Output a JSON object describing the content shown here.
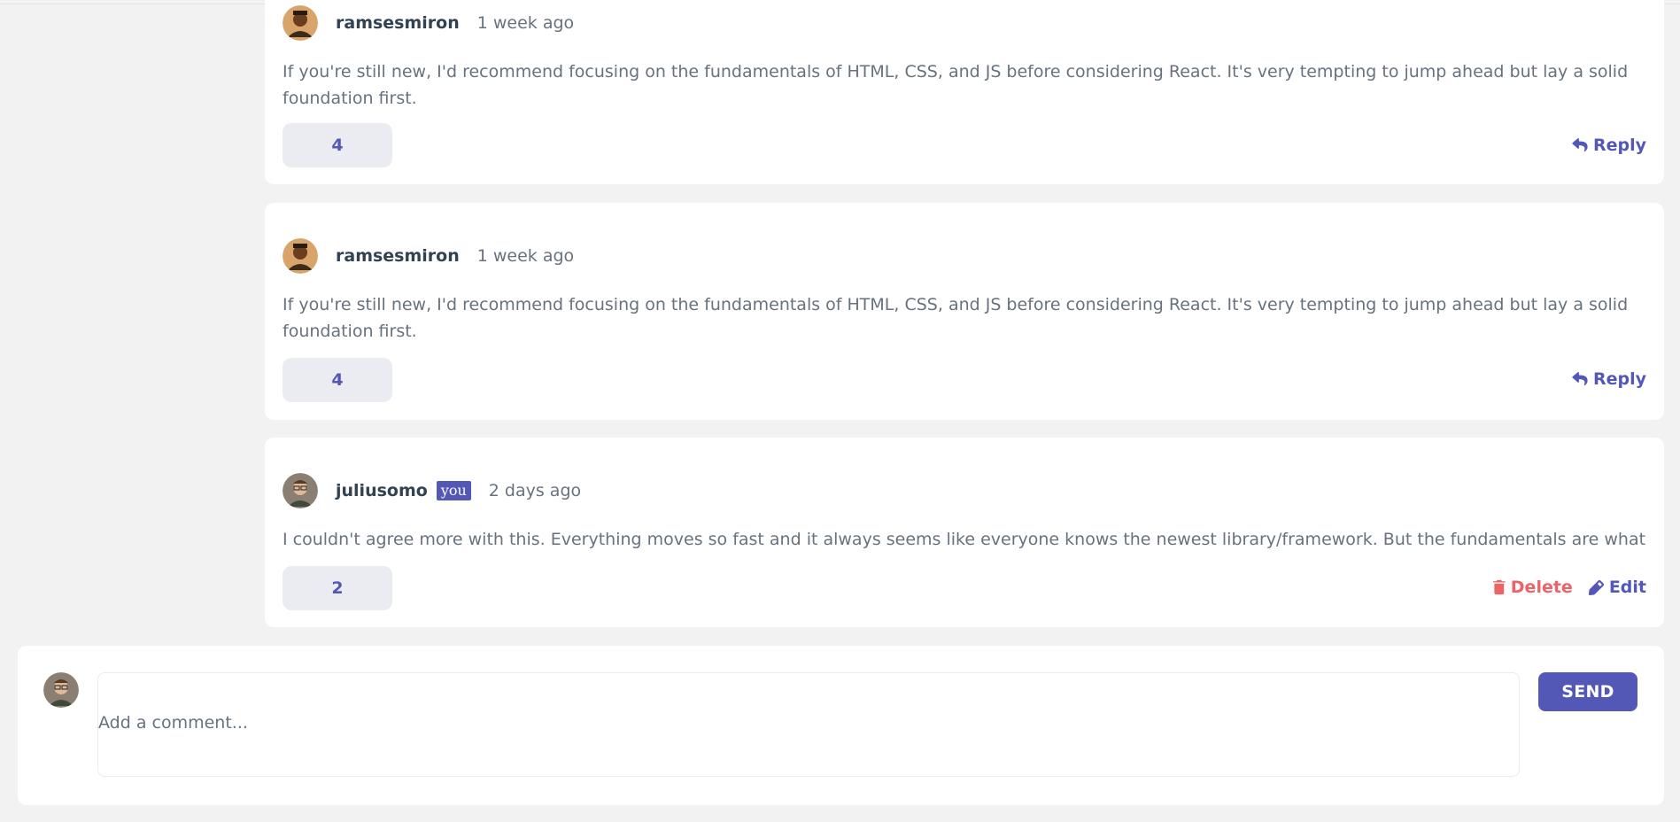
{
  "comments": [
    {
      "username": "ramsesmiron",
      "time": "1 week ago",
      "text": "If you're still new, I'd recommend focusing on the fundamentals of HTML, CSS, and JS before considering React. It's very tempting to jump ahead but lay a solid foundation first.",
      "score": "4",
      "reply_label": "Reply"
    },
    {
      "username": "ramsesmiron",
      "time": "1 week ago",
      "text": "If you're still new, I'd recommend focusing on the fundamentals of HTML, CSS, and JS before considering React. It's very tempting to jump ahead but lay a solid foundation first.",
      "score": "4",
      "reply_label": "Reply"
    },
    {
      "username": "juliusomo",
      "you_badge": "you",
      "time": "2 days ago",
      "text": "I couldn't agree more with this. Everything moves so fast and it always seems like everyone knows the newest library/framework. But the fundamentals are what stay c",
      "score": "2",
      "delete_label": "Delete",
      "edit_label": "Edit"
    }
  ],
  "composer": {
    "placeholder": "Add a comment...",
    "send_label": "SEND"
  },
  "colors": {
    "accent": "#5357b6",
    "danger": "#ed6368",
    "score_bg": "#eaecf1",
    "page_bg": "#f2f2f2"
  },
  "icons": {
    "reply": "reply-icon",
    "delete": "trash-icon",
    "edit": "pencil-icon"
  }
}
